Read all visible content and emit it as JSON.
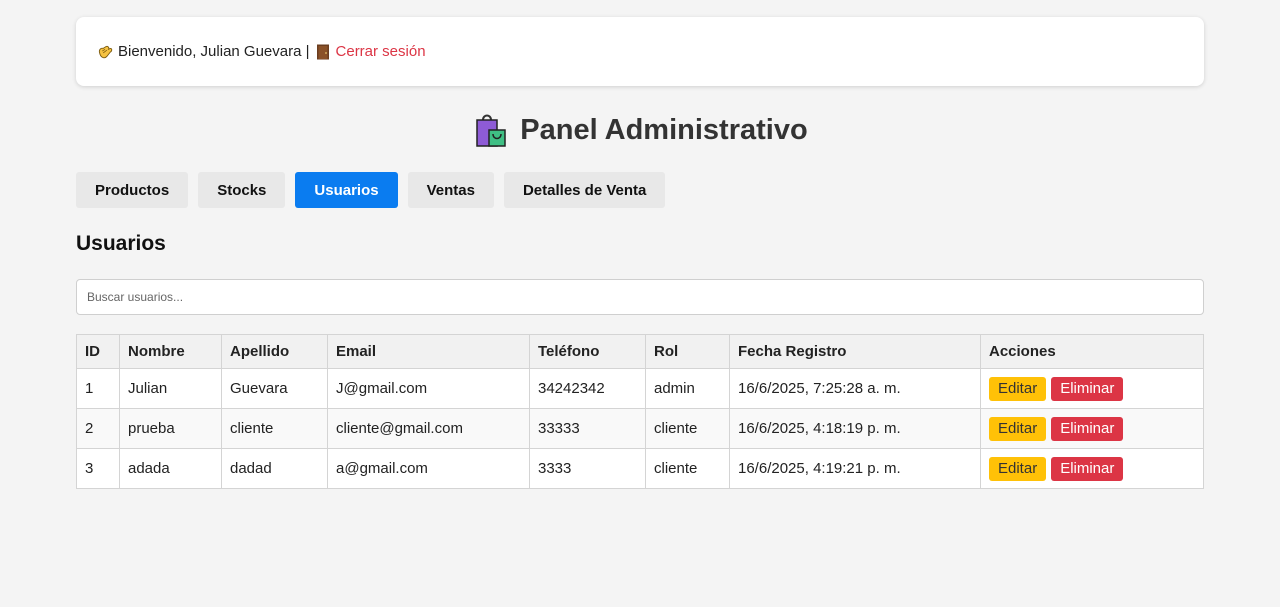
{
  "header": {
    "wave_icon": "waving-hand-icon",
    "welcome_text": "Bienvenido, Julian Guevara |",
    "door_icon": "door-icon",
    "logout_label": "Cerrar sesión",
    "logout_color": "#dc3545"
  },
  "page": {
    "title_icon": "shopping-bags-icon",
    "title": "Panel Administrativo"
  },
  "tabs": [
    {
      "label": "Productos",
      "active": false
    },
    {
      "label": "Stocks",
      "active": false
    },
    {
      "label": "Usuarios",
      "active": true
    },
    {
      "label": "Ventas",
      "active": false
    },
    {
      "label": "Detalles de Venta",
      "active": false
    }
  ],
  "accent_color": "#0a7cf0",
  "section": {
    "title": "Usuarios",
    "search_placeholder": "Buscar usuarios..."
  },
  "table": {
    "headers": [
      "ID",
      "Nombre",
      "Apellido",
      "Email",
      "Teléfono",
      "Rol",
      "Fecha Registro",
      "Acciones"
    ],
    "rows": [
      {
        "id": "1",
        "nombre": "Julian",
        "apellido": "Guevara",
        "email": "J@gmail.com",
        "telefono": "34242342",
        "rol": "admin",
        "fecha": "16/6/2025, 7:25:28 a. m."
      },
      {
        "id": "2",
        "nombre": "prueba",
        "apellido": "cliente",
        "email": "cliente@gmail.com",
        "telefono": "33333",
        "rol": "cliente",
        "fecha": "16/6/2025, 4:18:19 p. m."
      },
      {
        "id": "3",
        "nombre": "adada",
        "apellido": "dadad",
        "email": "a@gmail.com",
        "telefono": "3333",
        "rol": "cliente",
        "fecha": "16/6/2025, 4:19:21 p. m."
      }
    ],
    "edit_label": "Editar",
    "delete_label": "Eliminar",
    "edit_color": "#ffc107",
    "delete_color": "#dc3545"
  }
}
